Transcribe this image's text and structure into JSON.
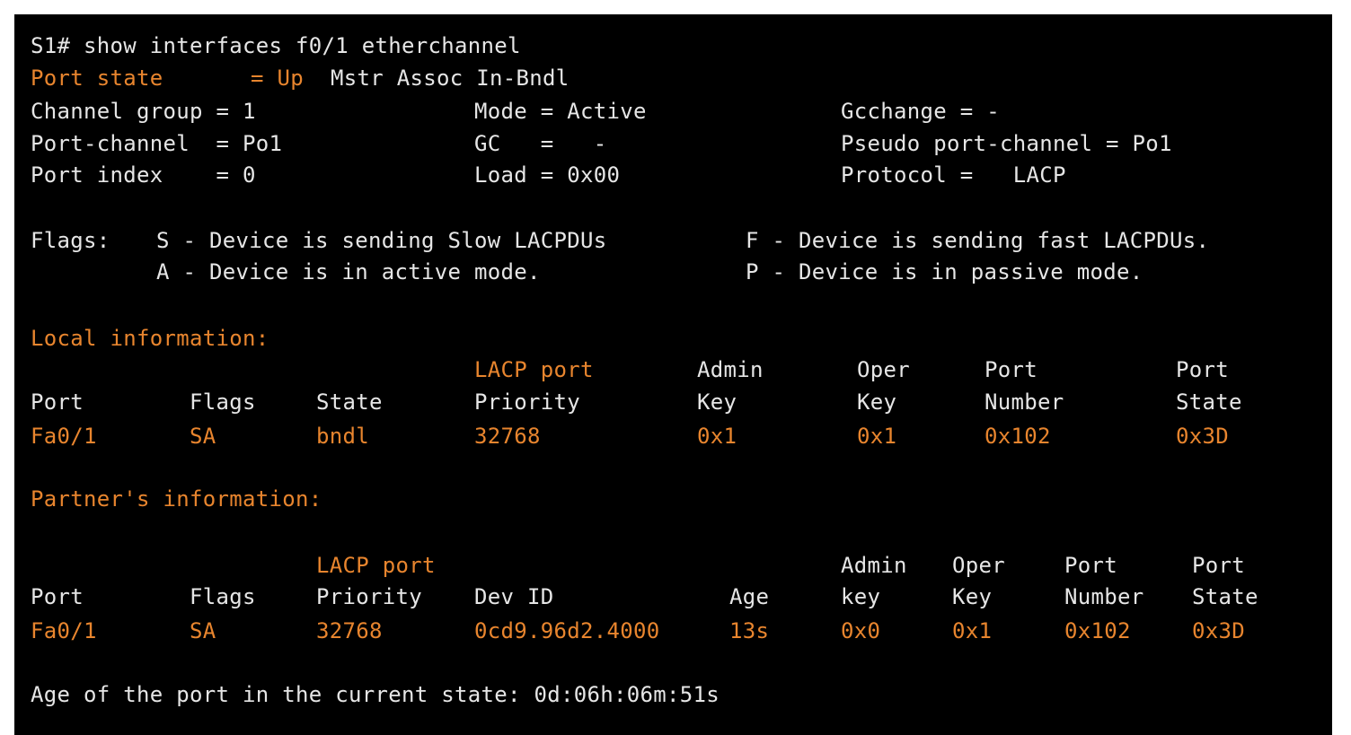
{
  "terminal": {
    "command": "S1# show interfaces f0/1 etherchannel",
    "port_state": {
      "label": "Port state",
      "eq_up": "= Up",
      "rest": "Mstr Assoc In-Bndl"
    },
    "summary": {
      "channel_group": "Channel group = 1",
      "mode": "Mode = Active",
      "gcchange": "Gcchange = -",
      "port_channel": "Port-channel  = Po1",
      "gc": "GC   =   -",
      "pseudo": "Pseudo port-channel = Po1",
      "port_index": "Port index    = 0",
      "load": "Load = 0x00",
      "protocol": "Protocol =   LACP"
    },
    "flags": {
      "label": "Flags:",
      "s": "S - Device is sending Slow LACPDUs",
      "f": "F - Device is sending fast LACPDUs.",
      "a": "A - Device is in active mode.",
      "p": "P - Device is in passive mode."
    },
    "local": {
      "title": "Local information:",
      "headers_top": {
        "lacp_port": "LACP port",
        "admin": "Admin",
        "oper": "Oper",
        "port_num": "Port",
        "port_state": "Port"
      },
      "headers": {
        "port": "Port",
        "flags": "Flags",
        "state": "State",
        "priority": "Priority",
        "admin_key": "Key",
        "oper_key": "Key",
        "number": "Number",
        "state2": "State"
      },
      "row": {
        "port": "Fa0/1",
        "flags": "SA",
        "state": "bndl",
        "priority": "32768",
        "admin_key": "0x1",
        "oper_key": "0x1",
        "number": "0x102",
        "port_state": "0x3D"
      }
    },
    "partner": {
      "title": "Partner's information:",
      "headers_top": {
        "lacp_port": "LACP port",
        "admin": "Admin",
        "oper": "Oper",
        "port_num": "Port",
        "port_state": "Port"
      },
      "headers": {
        "port": "Port",
        "flags": "Flags",
        "priority": "Priority",
        "dev_id": "Dev ID",
        "age": "Age",
        "admin_key": "key",
        "oper_key": "Key",
        "number": "Number",
        "state": "State"
      },
      "row": {
        "port": "Fa0/1",
        "flags": "SA",
        "priority": "32768",
        "dev_id": "0cd9.96d2.4000",
        "age": "13s",
        "admin_key": "0x0",
        "oper_key": "0x1",
        "number": "0x102",
        "port_state": "0x3D"
      }
    },
    "age_line": "Age of the port in the current state: 0d:06h:06m:51s"
  },
  "colors": {
    "background": "#000000",
    "text": "#e6e6e6",
    "highlight": "#e8852e",
    "page": "#ffffff"
  }
}
